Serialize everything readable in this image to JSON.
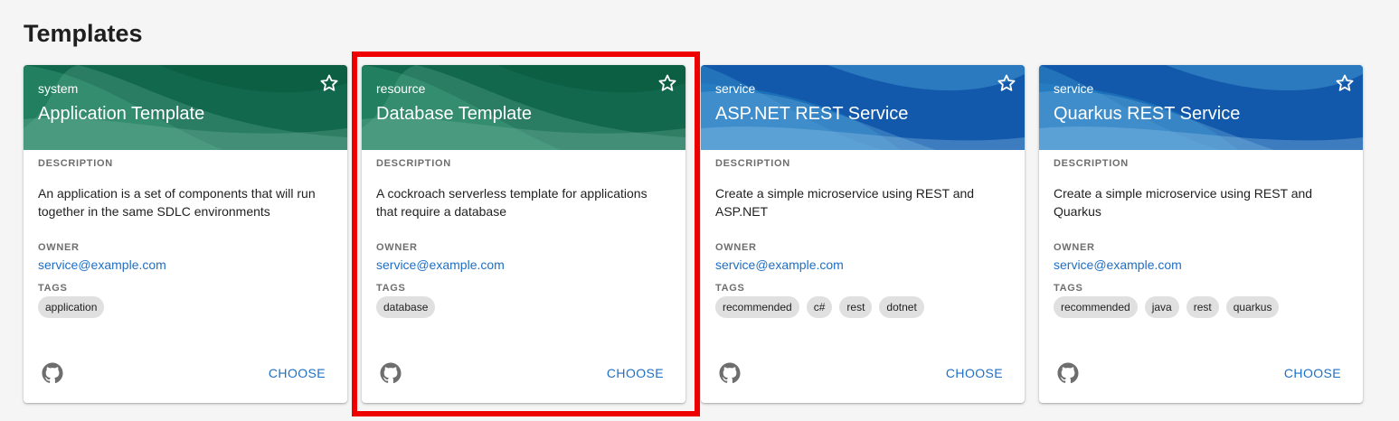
{
  "page": {
    "title": "Templates"
  },
  "labels": {
    "description": "DESCRIPTION",
    "owner": "OWNER",
    "tags": "TAGS",
    "choose": "CHOOSE"
  },
  "theme": {
    "green_header": "#1b7a5a",
    "blue_header": "#1565c0",
    "link_color": "#1f6fc4",
    "highlight": "#ee0000"
  },
  "cards": [
    {
      "type": "system",
      "title": "Application Template",
      "description": "An application is a set of components that will run together in the same SDLC environments",
      "owner": "service@example.com",
      "tags": [
        "application"
      ],
      "header_style": "green",
      "icons": {
        "star": "star-outline-icon",
        "source": "github-icon"
      }
    },
    {
      "type": "resource",
      "title": "Database Template",
      "description": "A cockroach serverless template for applications that require a database",
      "owner": "service@example.com",
      "tags": [
        "database"
      ],
      "header_style": "green",
      "selected": true,
      "icons": {
        "star": "star-outline-icon",
        "source": "github-icon"
      }
    },
    {
      "type": "service",
      "title": "ASP.NET REST Service",
      "description": "Create a simple microservice using REST and ASP.NET",
      "owner": "service@example.com",
      "tags": [
        "recommended",
        "c#",
        "rest",
        "dotnet"
      ],
      "header_style": "blue",
      "icons": {
        "star": "star-outline-icon",
        "source": "github-icon"
      }
    },
    {
      "type": "service",
      "title": "Quarkus REST Service",
      "description": "Create a simple microservice using REST and Quarkus",
      "owner": "service@example.com",
      "tags": [
        "recommended",
        "java",
        "rest",
        "quarkus"
      ],
      "header_style": "blue",
      "icons": {
        "star": "star-outline-icon",
        "source": "github-icon"
      }
    }
  ]
}
